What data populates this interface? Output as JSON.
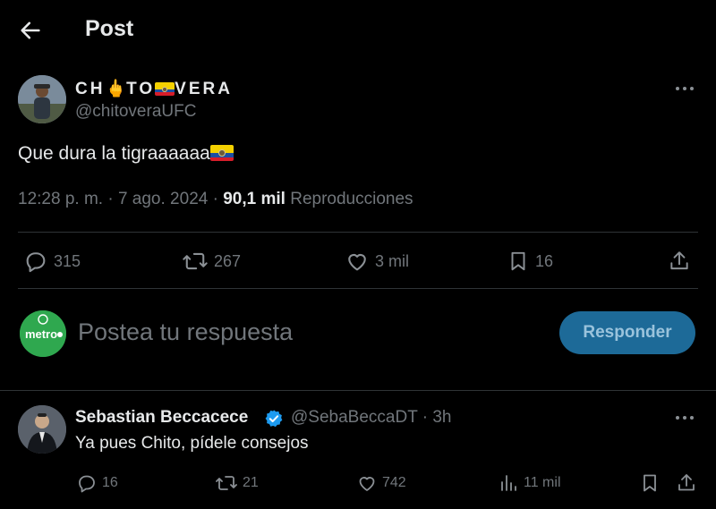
{
  "header": {
    "title": "Post"
  },
  "post": {
    "display_name_parts": [
      "CH",
      "TO",
      "VERA"
    ],
    "handle": "@chitoveraUFC",
    "text": "Que dura la tigraaaaaa",
    "time": "12:28 p. m.",
    "date": "7 ago. 2024",
    "views": "90,1 mil",
    "views_label": "Reproducciones",
    "flag_colors": [
      "#f4d100",
      "#1c4ea3",
      "#d71d2a"
    ]
  },
  "actions": {
    "replies": "315",
    "reposts": "267",
    "likes": "3 mil",
    "bookmarks": "16"
  },
  "composer": {
    "avatar_label": "metro",
    "placeholder": "Postea tu respuesta",
    "submit_label": "Responder"
  },
  "reply": {
    "name": "Sebastian Beccacece",
    "handle": "@SebaBeccaDT",
    "age": "3h",
    "text": "Ya pues Chito, pídele consejos",
    "replies": "16",
    "reposts": "21",
    "likes": "742",
    "views": "11 mil"
  },
  "colors": {
    "accent": "#1d9bf0",
    "button_bg": "#1d6a98",
    "muted": "#71767b",
    "divider": "#2f3336"
  }
}
